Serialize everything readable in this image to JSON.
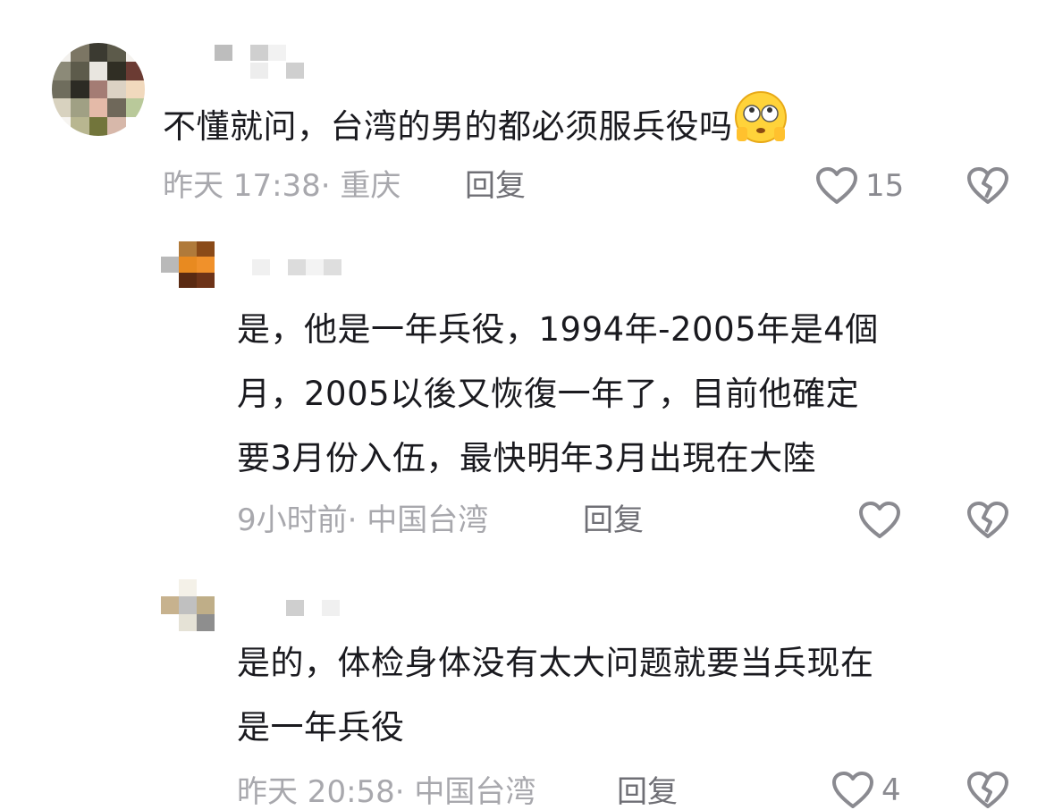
{
  "comments": [
    {
      "text_lines": [
        "不懂就问，台湾的男的都必须服兵役吗"
      ],
      "emoji": "flushed-face",
      "time": "昨天 17:38",
      "location": "· 重庆",
      "reply_label": "回复",
      "like_count": "15"
    },
    {
      "text_lines": [
        "是，他是一年兵役，1994年-2005年是4個",
        "月，2005以後又恢復一年了，目前他確定",
        "要3月份入伍，最快明年3月出現在大陸"
      ],
      "time": "9小时前",
      "location": "· 中国台湾",
      "reply_label": "回复",
      "like_count": ""
    },
    {
      "text_lines": [
        "是的，体检身体没有太大问题就要当兵现在",
        "是一年兵役"
      ],
      "time": "昨天 20:58",
      "location": "· 中国台湾",
      "reply_label": "回复",
      "like_count": "4"
    }
  ],
  "icons": {
    "like": "heart-outline-icon",
    "dislike": "broken-heart-icon"
  },
  "colors": {
    "text": "#1a1a1f",
    "meta": "#a8a8ad",
    "reply": "#6f6f75",
    "icon": "#8a8a90"
  }
}
